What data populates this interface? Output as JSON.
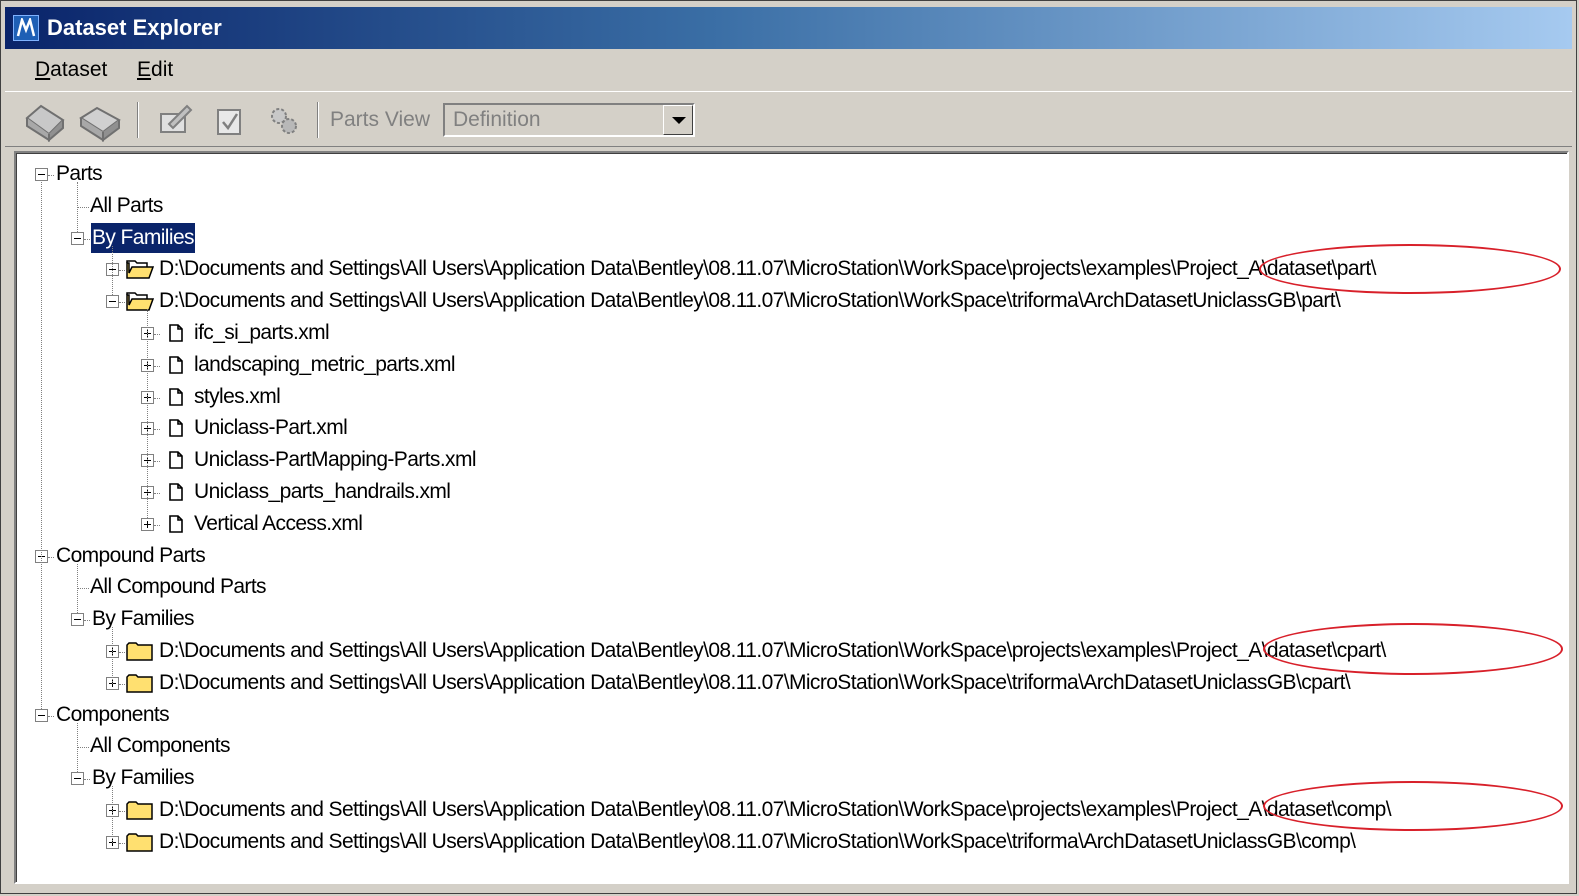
{
  "window": {
    "title": "Dataset Explorer"
  },
  "menubar": {
    "items": [
      "Dataset",
      "Edit"
    ]
  },
  "toolbar": {
    "parts_view_label": "Parts View",
    "parts_view_value": "Definition"
  },
  "tree": {
    "parts": {
      "label": "Parts",
      "all": "All Parts",
      "by_families": "By Families",
      "folders": [
        "D:\\Documents and Settings\\All Users\\Application Data\\Bentley\\08.11.07\\MicroStation\\WorkSpace\\projects\\examples\\Project_A\\dataset\\part\\",
        "D:\\Documents and Settings\\All Users\\Application Data\\Bentley\\08.11.07\\MicroStation\\WorkSpace\\triforma\\ArchDatasetUniclassGB\\part\\"
      ],
      "files": [
        "ifc_si_parts.xml",
        "landscaping_metric_parts.xml",
        "styles.xml",
        "Uniclass-Part.xml",
        "Uniclass-PartMapping-Parts.xml",
        "Uniclass_parts_handrails.xml",
        "Vertical Access.xml"
      ]
    },
    "compound_parts": {
      "label": "Compound Parts",
      "all": "All Compound Parts",
      "by_families": "By Families",
      "folders": [
        "D:\\Documents and Settings\\All Users\\Application Data\\Bentley\\08.11.07\\MicroStation\\WorkSpace\\projects\\examples\\Project_A\\dataset\\cpart\\",
        "D:\\Documents and Settings\\All Users\\Application Data\\Bentley\\08.11.07\\MicroStation\\WorkSpace\\triforma\\ArchDatasetUniclassGB\\cpart\\"
      ]
    },
    "components": {
      "label": "Components",
      "all": "All Components",
      "by_families": "By Families",
      "folders": [
        "D:\\Documents and Settings\\All Users\\Application Data\\Bentley\\08.11.07\\MicroStation\\WorkSpace\\projects\\examples\\Project_A\\dataset\\comp\\",
        "D:\\Documents and Settings\\All Users\\Application Data\\Bentley\\08.11.07\\MicroStation\\WorkSpace\\triforma\\ArchDatasetUniclassGB\\comp\\"
      ]
    }
  },
  "colors": {
    "title_start": "#0a246a",
    "title_end": "#a6caf0",
    "selection": "#0a246a",
    "annotation": "#d8202a",
    "folder": "#ffe070"
  },
  "icons": {
    "app": "dataset-explorer-app-icon",
    "toolbar": [
      "open-dataset-icon",
      "close-dataset-icon",
      "edit-icon",
      "properties-icon",
      "settings-icon"
    ],
    "folder_open": "folder-open-icon",
    "folder_closed": "folder-icon",
    "file": "document-icon"
  }
}
